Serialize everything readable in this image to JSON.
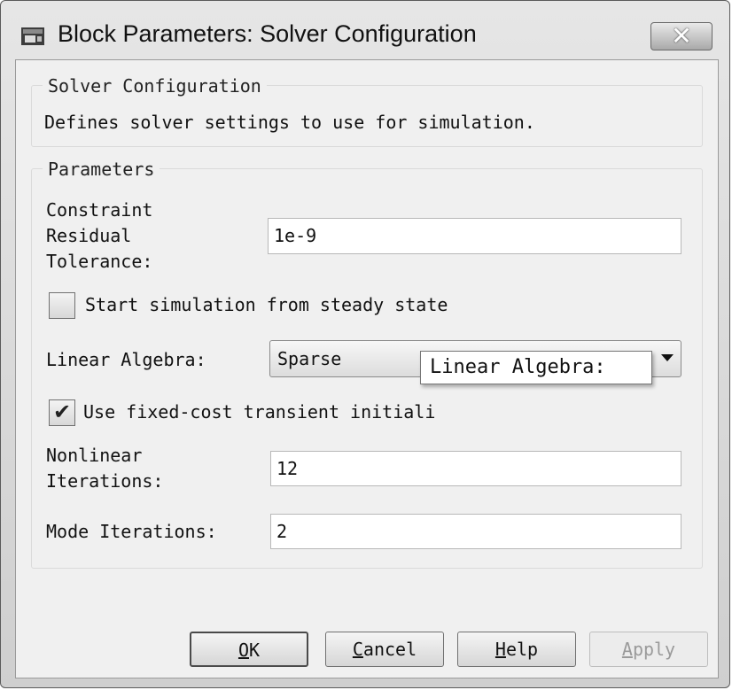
{
  "window": {
    "title": "Block Parameters: Solver Configuration",
    "icon": "simulink-block-icon",
    "close_label": "✕"
  },
  "description_group": {
    "legend": "Solver Configuration",
    "text": "Defines solver settings to use for simulation."
  },
  "parameters_group": {
    "legend": "Parameters",
    "constraint_tolerance": {
      "label_lines": [
        "Constraint",
        "Residual",
        "Tolerance:"
      ],
      "value": "1e-9"
    },
    "steady_state": {
      "label": "Start simulation from steady state",
      "checked": false
    },
    "linear_algebra": {
      "label": "Linear Algebra:",
      "value": "Sparse"
    },
    "fixed_cost": {
      "label_visible": "Use fixed-cost transient initiali",
      "checked": true
    },
    "nonlinear_iterations": {
      "label_lines": [
        "Nonlinear",
        "Iterations:"
      ],
      "value": "12"
    },
    "mode_iterations": {
      "label": "Mode Iterations:",
      "value": "2"
    }
  },
  "tooltip": {
    "text": "Linear Algebra:"
  },
  "buttons": {
    "ok": {
      "mnemonic": "O",
      "rest": "K"
    },
    "cancel": {
      "mnemonic": "C",
      "rest": "ancel"
    },
    "help": {
      "mnemonic": "H",
      "rest": "elp"
    },
    "apply": {
      "mnemonic": "A",
      "rest": "pply",
      "enabled": false
    }
  },
  "colors": {
    "window_frame": "#d6d6d6",
    "client_bg": "#f0f0f0",
    "tooltip_border": "#777777"
  }
}
